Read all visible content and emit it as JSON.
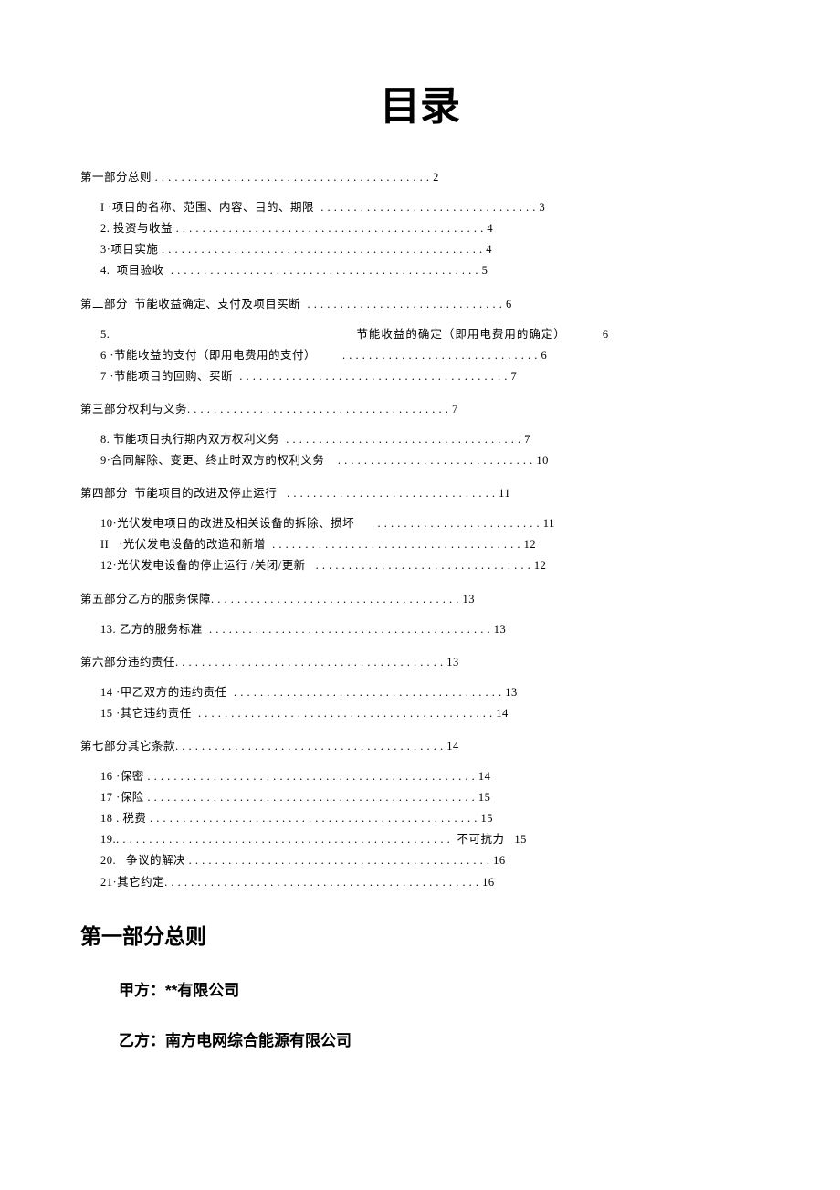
{
  "title": "目录",
  "toc": {
    "s1": {
      "line": "第一部分总则 . . . . . . . . . . . . . . . . . . . . . . . . . . . . . . . . . . . . . . . . . . 2",
      "i1": "I ·项目的名称、范围、内容、目的、期限  . . . . . . . . . . . . . . . . . . . . . . . . . . . . . . . . . 3",
      "i2": "2. 投资与收益 . . . . . . . . . . . . . . . . . . . . . . . . . . . . . . . . . . . . . . . . . . . . . . . 4",
      "i3": "3·项目实施 . . . . . . . . . . . . . . . . . . . . . . . . . . . . . . . . . . . . . . . . . . . . . . . . . 4",
      "i4": "4.  项目验收  . . . . . . . . . . . . . . . . . . . . . . . . . . . . . . . . . . . . . . . . . . . . . . . 5"
    },
    "s2": {
      "line": "第二部分  节能收益确定、支付及项目买断  . . . . . . . . . . . . . . . . . . . . . . . . . . . . . . 6",
      "i5_num": "5.",
      "i5_label": "节能收益的确定（即用电费用的确定）",
      "i5_page": "6",
      "i6": "6 ·节能收益的支付（即用电费用的支付）        . . . . . . . . . . . . . . . . . . . . . . . . . . . . . . 6",
      "i7": "7 ·节能项目的回购、买断  . . . . . . . . . . . . . . . . . . . . . . . . . . . . . . . . . . . . . . . . . 7"
    },
    "s3": {
      "line": "第三部分权利与义务. . . . . . . . . . . . . . . . . . . . . . . . . . . . . . . . . . . . . . . . 7",
      "i8": "8. 节能项目执行期内双方权利义务  . . . . . . . . . . . . . . . . . . . . . . . . . . . . . . . . . . . . 7",
      "i9": "9·合同解除、变更、终止时双方的权利义务    . . . . . . . . . . . . . . . . . . . . . . . . . . . . . . 10"
    },
    "s4": {
      "line": "第四部分  节能项目的改进及停止运行   . . . . . . . . . . . . . . . . . . . . . . . . . . . . . . . . 11",
      "i10": "10·光伏发电项目的改进及相关设备的拆除、损坏       . . . . . . . . . . . . . . . . . . . . . . . . . 11",
      "i11": "II   ·光伏发电设备的改造和新增  . . . . . . . . . . . . . . . . . . . . . . . . . . . . . . . . . . . . . . 12",
      "i12": "12·光伏发电设备的停止运行 /关闭/更新   . . . . . . . . . . . . . . . . . . . . . . . . . . . . . . . . . 12"
    },
    "s5": {
      "line": "第五部分乙方的服务保障. . . . . . . . . . . . . . . . . . . . . . . . . . . . . . . . . . . . . . 13",
      "i13": "13. 乙方的服务标准  . . . . . . . . . . . . . . . . . . . . . . . . . . . . . . . . . . . . . . . . . . . 13"
    },
    "s6": {
      "line": "第六部分违约责任. . . . . . . . . . . . . . . . . . . . . . . . . . . . . . . . . . . . . . . . . 13",
      "i14": "14 ·甲乙双方的违约责任  . . . . . . . . . . . . . . . . . . . . . . . . . . . . . . . . . . . . . . . . . 13",
      "i15": "15 ·其它违约责任  . . . . . . . . . . . . . . . . . . . . . . . . . . . . . . . . . . . . . . . . . . . . . 14"
    },
    "s7": {
      "line": "第七部分其它条款. . . . . . . . . . . . . . . . . . . . . . . . . . . . . . . . . . . . . . . . . 14",
      "i16": "16 ·保密 . . . . . . . . . . . . . . . . . . . . . . . . . . . . . . . . . . . . . . . . . . . . . . . . . . 14",
      "i17": "17 ·保险 . . . . . . . . . . . . . . . . . . . . . . . . . . . . . . . . . . . . . . . . . . . . . . . . . . 15",
      "i18": "18 . 税费 . . . . . . . . . . . . . . . . . . . . . . . . . . . . . . . . . . . . . . . . . . . . . . . . . . 15",
      "i19": "19.. . . . . . . . . . . . . . . . . . . . . . . . . . . . . . . . . . . . . . . . . . . . . . . . . . .  不可抗力   15",
      "i20": "20.   争议的解决 . . . . . . . . . . . . . . . . . . . . . . . . . . . . . . . . . . . . . . . . . . . . . . 16",
      "i21": "21·其它约定. . . . . . . . . . . . . . . . . . . . . . . . . . . . . . . . . . . . . . . . . . . . . . . . 16"
    }
  },
  "heading1": "第一部分总则",
  "partyA": "甲方：**有限公司",
  "partyB": "乙方：南方电网综合能源有限公司"
}
